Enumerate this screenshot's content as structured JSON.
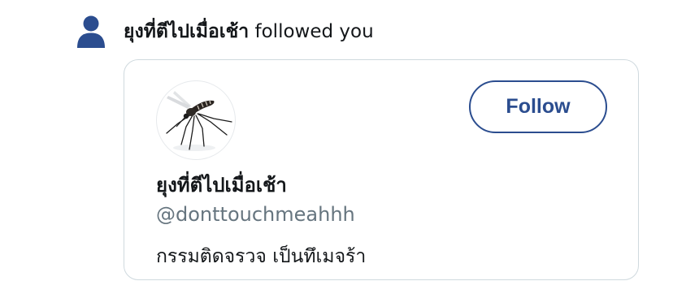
{
  "notification": {
    "icon": "person-icon",
    "actor_name": "ยุงที่ตีไปเมื่อเช้า",
    "action_text": " followed you"
  },
  "user_card": {
    "avatar": "mosquito-avatar",
    "display_name": "ยุงที่ตีไปเมื่อเช้า",
    "handle": "@donttouchmeahhh",
    "bio": "กรรมติดจรวจ เป็นทึเมจร้า",
    "follow_button_label": "Follow"
  },
  "colors": {
    "accent": "#2b4d8f",
    "handle_gray": "#66757f",
    "card_border": "#cfd9de",
    "text": "#14171a"
  }
}
